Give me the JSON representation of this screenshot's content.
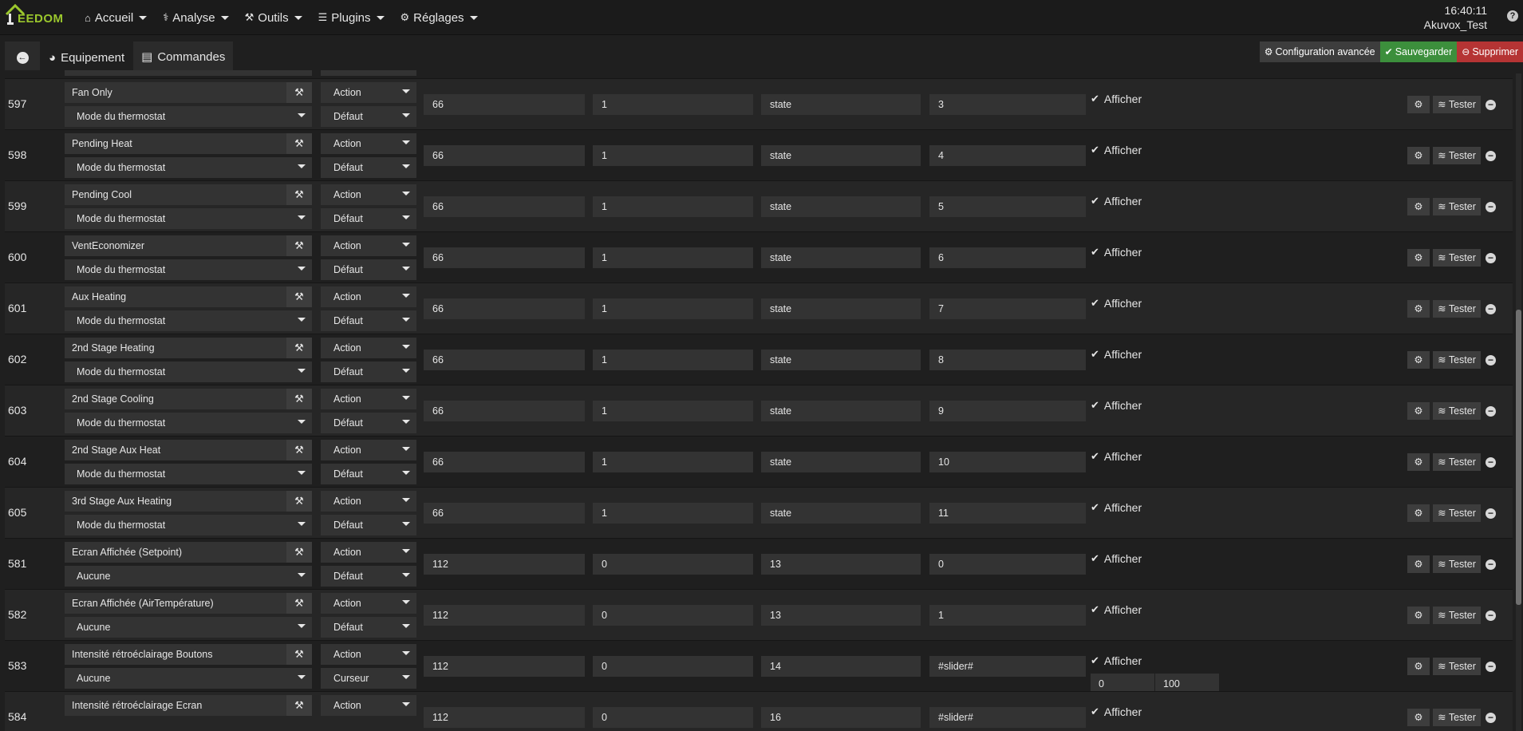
{
  "app": {
    "logo_text": "EEDOM"
  },
  "nav": {
    "items": [
      {
        "label": "Accueil",
        "icon": "home-icon"
      },
      {
        "label": "Analyse",
        "icon": "stethoscope-icon"
      },
      {
        "label": "Outils",
        "icon": "wrench-icon"
      },
      {
        "label": "Plugins",
        "icon": "list-icon"
      },
      {
        "label": "Réglages",
        "icon": "gear-icon"
      }
    ],
    "time": "16:40:11",
    "user": "Akuvox_Test",
    "help": "?"
  },
  "toolbar": {
    "tab_equipement": "Equipement",
    "tab_commandes": "Commandes",
    "config_label": "Configuration avancée",
    "save_label": "Sauvegarder",
    "delete_label": "Supprimer"
  },
  "table": {
    "afficher_label": "Afficher",
    "tester_label": "Tester",
    "rows": [
      {
        "id": "",
        "name": "",
        "subname": "Mode du thermostat",
        "type": "",
        "subtype": "Défaut",
        "v1": "",
        "v2": "",
        "v3": "",
        "v4": "",
        "partial": true
      },
      {
        "id": "597",
        "name": "Fan Only",
        "subname": "Mode du thermostat",
        "type": "Action",
        "subtype": "Défaut",
        "v1": "66",
        "v2": "1",
        "v3": "state",
        "v4": "3"
      },
      {
        "id": "598",
        "name": "Pending Heat",
        "subname": "Mode du thermostat",
        "type": "Action",
        "subtype": "Défaut",
        "v1": "66",
        "v2": "1",
        "v3": "state",
        "v4": "4"
      },
      {
        "id": "599",
        "name": "Pending Cool",
        "subname": "Mode du thermostat",
        "type": "Action",
        "subtype": "Défaut",
        "v1": "66",
        "v2": "1",
        "v3": "state",
        "v4": "5"
      },
      {
        "id": "600",
        "name": "VentEconomizer",
        "subname": "Mode du thermostat",
        "type": "Action",
        "subtype": "Défaut",
        "v1": "66",
        "v2": "1",
        "v3": "state",
        "v4": "6"
      },
      {
        "id": "601",
        "name": "Aux Heating",
        "subname": "Mode du thermostat",
        "type": "Action",
        "subtype": "Défaut",
        "v1": "66",
        "v2": "1",
        "v3": "state",
        "v4": "7"
      },
      {
        "id": "602",
        "name": "2nd Stage Heating",
        "subname": "Mode du thermostat",
        "type": "Action",
        "subtype": "Défaut",
        "v1": "66",
        "v2": "1",
        "v3": "state",
        "v4": "8"
      },
      {
        "id": "603",
        "name": "2nd Stage Cooling",
        "subname": "Mode du thermostat",
        "type": "Action",
        "subtype": "Défaut",
        "v1": "66",
        "v2": "1",
        "v3": "state",
        "v4": "9"
      },
      {
        "id": "604",
        "name": "2nd Stage Aux Heat",
        "subname": "Mode du thermostat",
        "type": "Action",
        "subtype": "Défaut",
        "v1": "66",
        "v2": "1",
        "v3": "state",
        "v4": "10"
      },
      {
        "id": "605",
        "name": "3rd Stage Aux Heating",
        "subname": "Mode du thermostat",
        "type": "Action",
        "subtype": "Défaut",
        "v1": "66",
        "v2": "1",
        "v3": "state",
        "v4": "11"
      },
      {
        "id": "581",
        "name": "Ecran Affichée (Setpoint)",
        "subname": "Aucune",
        "type": "Action",
        "subtype": "Défaut",
        "v1": "112",
        "v2": "0",
        "v3": "13",
        "v4": "0"
      },
      {
        "id": "582",
        "name": " Ecran Affichée (AirTempérature)",
        "subname": "Aucune",
        "type": "Action",
        "subtype": "Défaut",
        "v1": "112",
        "v2": "0",
        "v3": "13",
        "v4": "1"
      },
      {
        "id": "583",
        "name": "Intensité rétroéclairage Boutons",
        "subname": "Aucune",
        "type": "Action",
        "subtype": "Curseur",
        "v1": "112",
        "v2": "0",
        "v3": "14",
        "v4": "#slider#",
        "min": "0",
        "max": "100"
      },
      {
        "id": "584",
        "name": "Intensité rétroéclairage Ecran",
        "subname": "",
        "type": "Action",
        "subtype": "",
        "v1": "112",
        "v2": "0",
        "v3": "16",
        "v4": "#slider#"
      }
    ]
  }
}
